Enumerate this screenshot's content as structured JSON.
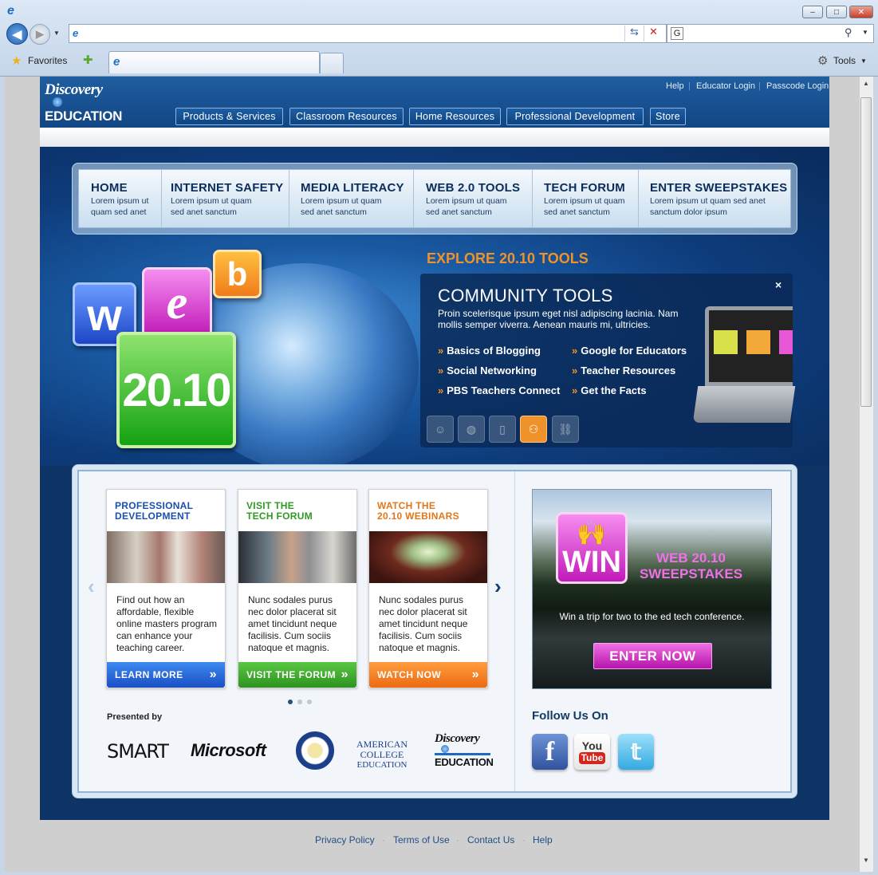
{
  "browser": {
    "favorites_label": "Favorites",
    "tools_label": "Tools"
  },
  "site": {
    "logo": {
      "line1": "Discovery",
      "line2": "EDUCATION"
    },
    "top_links": [
      "Help",
      "Educator Login",
      "Passcode Login"
    ],
    "top_nav": [
      "Products & Services",
      "Classroom Resources",
      "Home Resources",
      "Professional Development",
      "Store"
    ],
    "tabs": [
      {
        "title": "HOME",
        "sub1": "Lorem ipsum ut",
        "sub2": "quam sed anet"
      },
      {
        "title": "INTERNET SAFETY",
        "sub1": "Lorem ipsum ut quam",
        "sub2": "sed anet sanctum"
      },
      {
        "title": "MEDIA LITERACY",
        "sub1": "Lorem ipsum ut quam",
        "sub2": "sed anet sanctum"
      },
      {
        "title": "WEB 2.0 TOOLS",
        "sub1": "Lorem ipsum ut quam",
        "sub2": "sed anet sanctum"
      },
      {
        "title": "TECH FORUM",
        "sub1": "Lorem ipsum ut quam",
        "sub2": "sed anet sanctum"
      },
      {
        "title": "ENTER SWEEPSTAKES",
        "sub1": "Lorem ipsum ut quam sed anet",
        "sub2": "sanctum dolor ipsum"
      }
    ],
    "hero": {
      "logo": {
        "w": "w",
        "e": "e",
        "b": "b",
        "year": "20.10"
      },
      "explore": "EXPLORE 20.10 TOOLS",
      "community_title": "COMMUNITY TOOLS",
      "community_desc": "Proin scelerisque ipsum eget nisl adipiscing lacinia. Nam mollis semper viverra. Aenean mauris mi, ultricies.",
      "links_left": [
        "Basics of Blogging",
        "Social Networking",
        "PBS Teachers Connect"
      ],
      "links_right": [
        "Google for Educators",
        "Teacher Resources",
        "Get the Facts"
      ],
      "close": "×"
    },
    "cards": [
      {
        "title1": "PROFESSIONAL",
        "title2": "DEVELOPMENT",
        "text": "Find out how an affordable, flexible online masters program can enhance your teaching career.",
        "button": "LEARN MORE"
      },
      {
        "title1": "VISIT THE",
        "title2": "TECH FORUM",
        "text": "Nunc sodales purus nec dolor placerat sit amet tincidunt neque facilisis. Cum sociis natoque et magnis.",
        "button": "VISIT THE FORUM"
      },
      {
        "title1": "WATCH THE",
        "title2": "20.10 WEBINARS",
        "text": "Nunc sodales purus nec dolor placerat sit amet tincidunt neque facilisis. Cum sociis natoque et magnis.",
        "button": "WATCH NOW"
      }
    ],
    "presented_by": "Presented by",
    "sponsors": {
      "smart": "SMART",
      "microsoft": "Microsoft",
      "acoe1": "AMERICAN COLLEGE",
      "acoe2": "EDUCATION",
      "de1": "Discovery",
      "de2": "EDUCATION"
    },
    "win": {
      "badge": "WIN",
      "title1": "WEB 20.10",
      "title2": "SWEEPSTAKES",
      "text": "Win a trip for two to the ed tech conference.",
      "button": "ENTER NOW"
    },
    "follow": "Follow Us On",
    "social": {
      "facebook": "f",
      "youtube1": "You",
      "youtube2": "Tube"
    },
    "footer": [
      "Privacy Policy",
      "Terms of Use",
      "Contact Us",
      "Help"
    ]
  },
  "colors": {
    "accent_orange": "#f0922a",
    "nav_blue": "#0e4482",
    "win_pink": "#c21ab8",
    "learn_blue": "#1a5fd0",
    "forum_green": "#37a22a",
    "watch_orange": "#f07b1a"
  }
}
